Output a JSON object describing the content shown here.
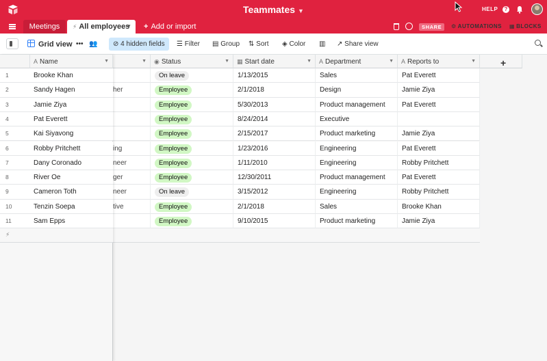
{
  "header": {
    "base_name": "Teammates",
    "help_label": "HELP",
    "share_label": "SHARE",
    "automations_label": "AUTOMATIONS",
    "blocks_label": "BLOCKS"
  },
  "tabs": [
    {
      "label": "Meetings",
      "active": false
    },
    {
      "label": "All employees",
      "active": true
    },
    {
      "label": "Add or import",
      "active": false
    }
  ],
  "toolbar": {
    "view_name": "Grid view",
    "hidden_fields": "4 hidden fields",
    "filter": "Filter",
    "group": "Group",
    "sort": "Sort",
    "color": "Color",
    "share_view": "Share view"
  },
  "columns": {
    "name": "Name",
    "status": "Status",
    "start_date": "Start date",
    "department": "Department",
    "reports_to": "Reports to"
  },
  "rows": [
    {
      "num": "1",
      "name": "Brooke Khan",
      "partial": "",
      "status": "On leave",
      "start": "1/13/2015",
      "dept": "Sales",
      "reports": "Pat Everett"
    },
    {
      "num": "2",
      "name": "Sandy Hagen",
      "partial": "her",
      "status": "Employee",
      "start": "2/1/2018",
      "dept": "Design",
      "reports": "Jamie Ziya"
    },
    {
      "num": "3",
      "name": "Jamie Ziya",
      "partial": "",
      "status": "Employee",
      "start": "5/30/2013",
      "dept": "Product management",
      "reports": "Pat Everett"
    },
    {
      "num": "4",
      "name": "Pat Everett",
      "partial": "",
      "status": "Employee",
      "start": "8/24/2014",
      "dept": "Executive",
      "reports": ""
    },
    {
      "num": "5",
      "name": "Kai Siyavong",
      "partial": "",
      "status": "Employee",
      "start": "2/15/2017",
      "dept": "Product marketing",
      "reports": "Jamie Ziya"
    },
    {
      "num": "6",
      "name": "Robby Pritchett",
      "partial": "ing",
      "status": "Employee",
      "start": "1/23/2016",
      "dept": "Engineering",
      "reports": "Pat Everett"
    },
    {
      "num": "7",
      "name": "Dany Coronado",
      "partial": "neer",
      "status": "Employee",
      "start": "1/11/2010",
      "dept": "Engineering",
      "reports": "Robby Pritchett"
    },
    {
      "num": "8",
      "name": "River Oe",
      "partial": "ger",
      "status": "Employee",
      "start": "12/30/2011",
      "dept": "Product management",
      "reports": "Pat Everett"
    },
    {
      "num": "9",
      "name": "Cameron Toth",
      "partial": "neer",
      "status": "On leave",
      "start": "3/15/2012",
      "dept": "Engineering",
      "reports": "Robby Pritchett"
    },
    {
      "num": "10",
      "name": "Tenzin Soepa",
      "partial": "tive",
      "status": "Employee",
      "start": "2/1/2018",
      "dept": "Sales",
      "reports": "Brooke Khan"
    },
    {
      "num": "11",
      "name": "Sam Epps",
      "partial": "",
      "status": "Employee",
      "start": "9/10/2015",
      "dept": "Product marketing",
      "reports": "Jamie Ziya"
    }
  ],
  "colors": {
    "brand_red": "#e0223f",
    "employee_pill": "#d1f7c4",
    "leave_pill": "#eeeeee",
    "hidden_fields_bg": "#cfe8fc"
  }
}
